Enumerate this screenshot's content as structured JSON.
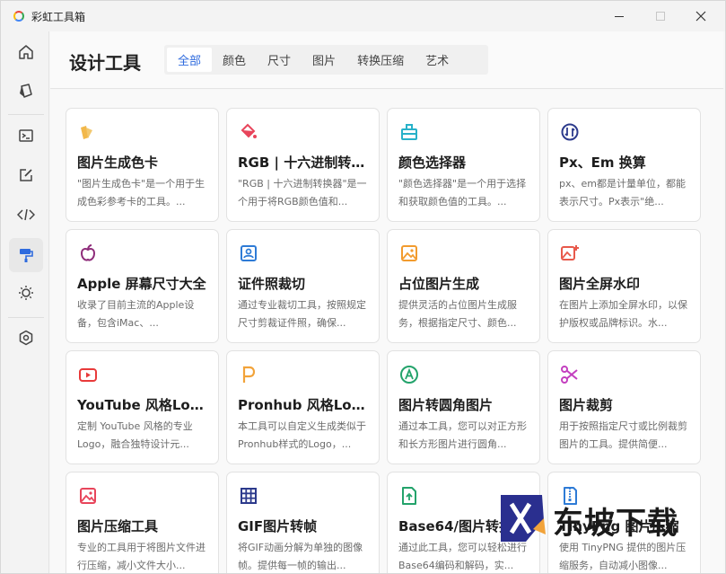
{
  "window": {
    "title": "彩虹工具箱"
  },
  "header": {
    "title": "设计工具",
    "tabs": [
      {
        "label": "全部",
        "active": true
      },
      {
        "label": "颜色",
        "active": false
      },
      {
        "label": "尺寸",
        "active": false
      },
      {
        "label": "图片",
        "active": false
      },
      {
        "label": "转换压缩",
        "active": false
      },
      {
        "label": "艺术",
        "active": false
      }
    ]
  },
  "sidebar": {
    "items": [
      {
        "icon": "home-icon"
      },
      {
        "icon": "cube-icon"
      },
      {
        "icon": "terminal-icon"
      },
      {
        "icon": "edit-icon"
      },
      {
        "icon": "code-icon"
      },
      {
        "icon": "paint-roller-icon",
        "active": true
      },
      {
        "icon": "sun-icon"
      },
      {
        "icon": "settings-icon"
      }
    ]
  },
  "cards": [
    {
      "title": "图片生成色卡",
      "desc": "\"图片生成色卡\"是一个用于生成色彩参考卡的工具。...",
      "icon": "palette-swatch-icon",
      "color": "#f2b84b"
    },
    {
      "title": "RGB | 十六进制转换器",
      "desc": "\"RGB | 十六进制转换器\"是一个用于将RGB颜色值和...",
      "icon": "paint-bucket-icon",
      "color": "#e8455b"
    },
    {
      "title": "颜色选择器",
      "desc": "\"颜色选择器\"是一个用于选择和获取颜色值的工具。...",
      "icon": "color-picker-icon",
      "color": "#27b1c9"
    },
    {
      "title": "Px、Em 换算",
      "desc": "px、em都是计量单位，都能表示尺寸。Px表示\"绝...",
      "icon": "convert-icon",
      "color": "#2c3a8c"
    },
    {
      "title": "Apple 屏幕尺寸大全",
      "desc": "收录了目前主流的Apple设备，包含iMac、...",
      "icon": "apple-icon",
      "color": "#8e2c7a"
    },
    {
      "title": "证件照裁切",
      "desc": "通过专业裁切工具，按照规定尺寸剪裁证件照，确保...",
      "icon": "id-photo-icon",
      "color": "#2e7bd6"
    },
    {
      "title": "占位图片生成",
      "desc": "提供灵活的占位图片生成服务，根据指定尺寸、颜色...",
      "icon": "image-placeholder-icon",
      "color": "#f29b2e"
    },
    {
      "title": "图片全屏水印",
      "desc": "在图片上添加全屏水印，以保护版权或品牌标识。水...",
      "icon": "image-watermark-icon",
      "color": "#e8594b"
    },
    {
      "title": "YouTube 风格Logo生成",
      "desc": "定制 YouTube 风格的专业Logo，融合独特设计元...",
      "icon": "youtube-icon",
      "color": "#e83a3a"
    },
    {
      "title": "Pronhub 风格Logo生成",
      "desc": "本工具可以自定义生成类似于Pronhub样式的Logo，...",
      "icon": "letter-p-icon",
      "color": "#f2a33a"
    },
    {
      "title": "图片转圆角图片",
      "desc": "通过本工具，您可以对正方形和长方形图片进行圆角...",
      "icon": "rounded-image-icon",
      "color": "#23a36b"
    },
    {
      "title": "图片裁剪",
      "desc": "用于按照指定尺寸或比例裁剪图片的工具。提供简便...",
      "icon": "scissors-icon",
      "color": "#c33fbf"
    },
    {
      "title": "图片压缩工具",
      "desc": "专业的工具用于将图片文件进行压缩，减小文件大小...",
      "icon": "image-compress-icon",
      "color": "#e8455b"
    },
    {
      "title": "GIF图片转帧",
      "desc": "将GIF动画分解为单独的图像帧。提供每一帧的输出...",
      "icon": "grid-frames-icon",
      "color": "#2c3a8c"
    },
    {
      "title": "Base64/图片转换",
      "desc": "通过此工具，您可以轻松进行Base64编码和解码，实...",
      "icon": "file-upload-icon",
      "color": "#23a36b"
    },
    {
      "title": "TinyPng 图片压缩",
      "desc": "使用 TinyPNG 提供的图片压缩服务，自动减小图像...",
      "icon": "zip-file-icon",
      "color": "#2e7bd6"
    }
  ],
  "watermark": {
    "text": "东坡下载"
  }
}
